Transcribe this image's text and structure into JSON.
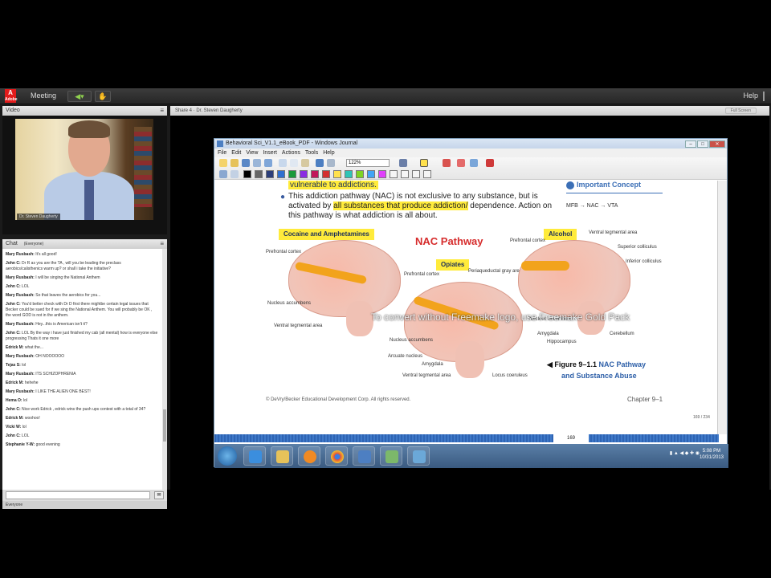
{
  "topbar": {
    "logo_letter": "A",
    "logo_sub": "Adobe",
    "meeting": "Meeting",
    "help": "Help"
  },
  "video_pod": {
    "title": "Video",
    "presenter": "Dr. Steven Daugherty"
  },
  "chat_pod": {
    "title": "Chat",
    "scope": "(Everyone)",
    "footer": "Everyone",
    "messages": [
      {
        "user": "Mary Rusbash:",
        "text": "It's all good!"
      },
      {
        "user": "John C:",
        "text": "Dr R as you are the TA , will you be leading the preclass aerobics/calisthenics warm up? or shall i take the initiative?"
      },
      {
        "user": "Mary Rusbash:",
        "text": "I will be singing the National Anthem"
      },
      {
        "user": "John C:",
        "text": "LOL"
      },
      {
        "user": "Mary Rusbash:",
        "text": "So that leaves the aerobics for you..."
      },
      {
        "user": "John C:",
        "text": "You'd better check with Dr D first there mightbe certain legal issues that Becker could be sued for if we sing the National Anthem. You will probably be OK , the word GOD is not in the anthem."
      },
      {
        "user": "Mary Rusbash:",
        "text": "Hey...this is American isn't it?"
      },
      {
        "user": "John C:",
        "text": "LOL By the way i have just finished my cab (all mental) how is everyone else progressing Thats it one more"
      },
      {
        "user": "Edrick M:",
        "text": "what the..."
      },
      {
        "user": "Mary Rusbash:",
        "text": "OH NOOOOOO"
      },
      {
        "user": "Tejas S:",
        "text": "lol"
      },
      {
        "user": "Mary Rusbash:",
        "text": "ITS SCHIZOPHRENIA"
      },
      {
        "user": "Edrick M:",
        "text": "hehehe"
      },
      {
        "user": "Mary Rusbash:",
        "text": "I LIKE THE ALIEN ONE BEST!"
      },
      {
        "user": "Hema O:",
        "text": "lol"
      },
      {
        "user": "John C:",
        "text": "Nice work Edrick , edrick wins the push ups contest with a total of 34?"
      },
      {
        "user": "Edrick M:",
        "text": "woohoo!"
      },
      {
        "user": "Vicki W:",
        "text": "lol"
      },
      {
        "user": "John C:",
        "text": "LOL"
      },
      {
        "user": "Stephanie Y-W:",
        "text": "good evening"
      }
    ]
  },
  "share_pod": {
    "title": "Share 4 · Dr. Steven Daugherty",
    "fullscreen": "Full Screen"
  },
  "journal": {
    "title": "Behavioral Sci_V1.1_eBook_PDF - Windows Journal",
    "menu": [
      "File",
      "Edit",
      "View",
      "Insert",
      "Actions",
      "Tools",
      "Help"
    ],
    "zoom": "122%",
    "line1": "vulnerable to addictions.",
    "bullet_a": "This addiction pathway (NAC) is not exclusive to any substance, but is activated by ",
    "bullet_hl": "all substances that produce addiction/",
    "bullet_b": " dependence. Action on this pathway is what addiction is all about.",
    "important": "Important Concept",
    "mfb": "MFB → NAC → VTA",
    "label_cocaine": "Cocaine and Amphetamines",
    "label_nac": "NAC Pathway",
    "label_opiates": "Opiates",
    "label_alcohol": "Alcohol",
    "anat": {
      "pfc1": "Prefrontal cortex",
      "nacc1": "Nucleus accumbens",
      "vta1": "Ventral tegmental area",
      "pfc2": "Prefrontal cortex",
      "pag": "Periaqueductal gray area",
      "nacc2": "Nucleus accumbens",
      "arcuate": "Arcuate nucleus",
      "amyg2": "Amygdala",
      "vta2": "Ventral tegmental area",
      "lc": "Locus coeruleus",
      "pfc3": "Prefrontal cortex",
      "vta3": "Ventral tegmental area",
      "sup": "Superior colliculus",
      "inf": "Inferior colliculus",
      "nacc3": "Nucleus accumbens",
      "amyg3": "Amygdala",
      "hippo": "Hippocampus",
      "cereb": "Cerebellum"
    },
    "figure_prefix": "◀ Figure  9–1.1 ",
    "figure_a": "NAC Pathway",
    "figure_b": "and Substance Abuse",
    "copyright": "© DeVry/Becker Educational Development Corp. All rights reserved.",
    "chapter": "Chapter 9–1",
    "page_count": "169 / 234",
    "page_num": "169"
  },
  "watermark": "To convert without Freemake logo, use Freemake Gold Pack",
  "clock": {
    "time": "5:08 PM",
    "date": "10/31/2013"
  }
}
